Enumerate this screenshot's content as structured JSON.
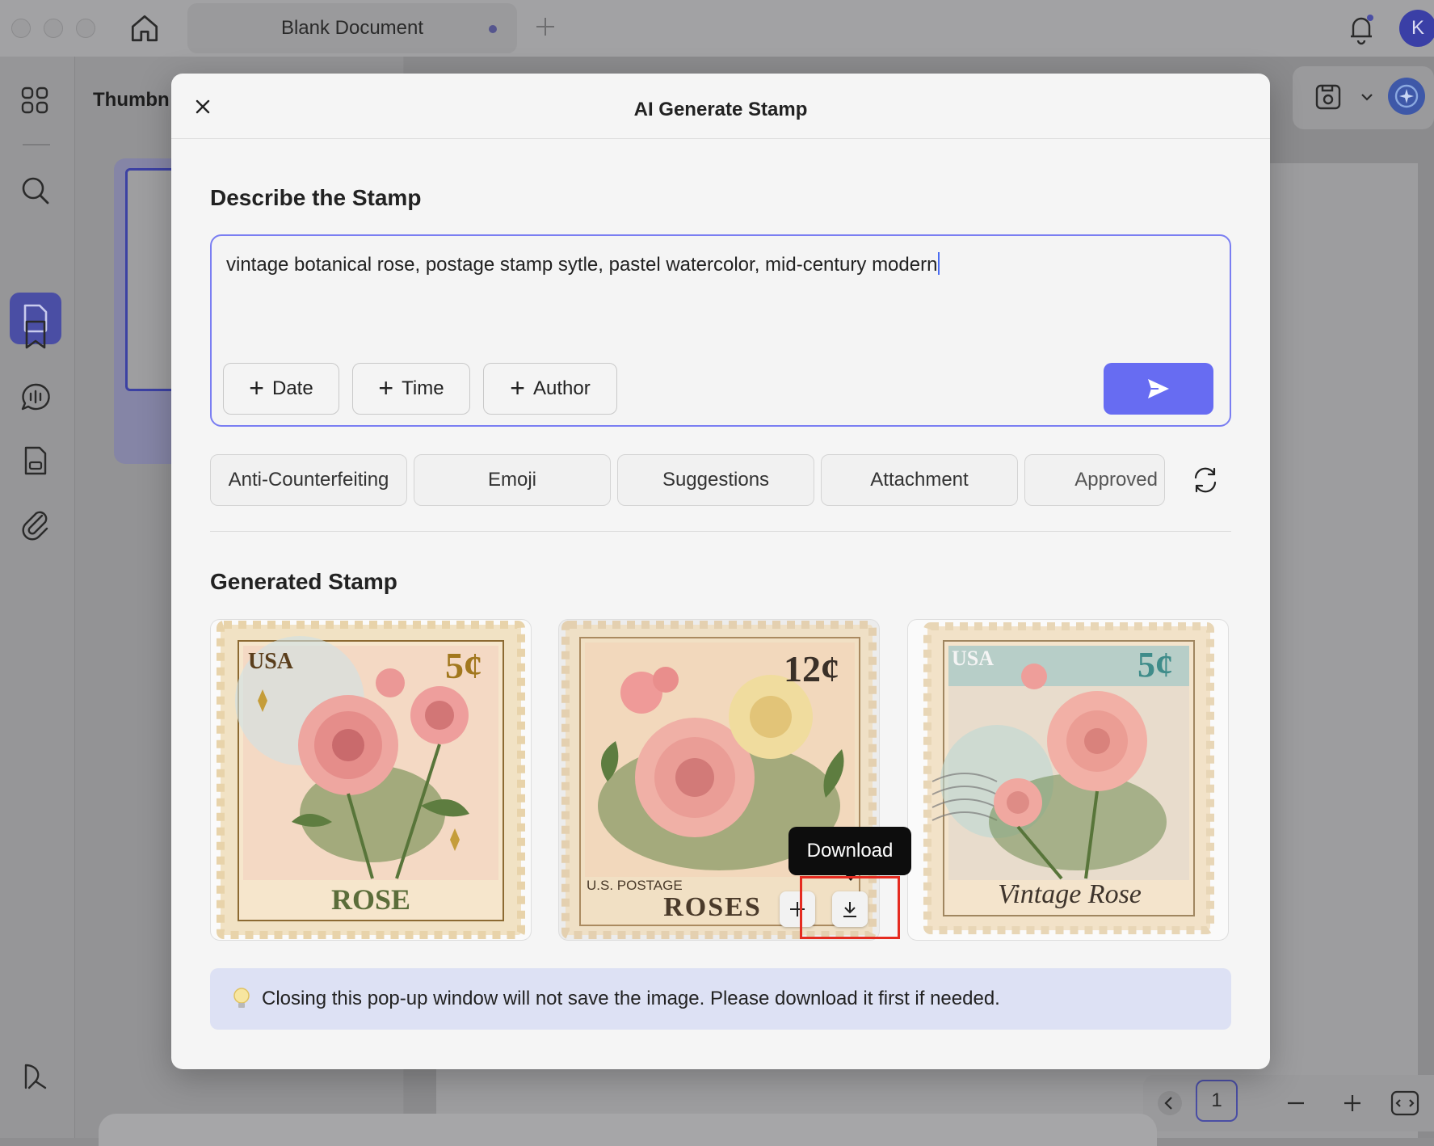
{
  "titlebar": {
    "tab_title": "Blank Document",
    "avatar_initial": "K"
  },
  "thumbnail_panel": {
    "title": "Thumbn"
  },
  "bottom_nav": {
    "page_number": "1"
  },
  "modal": {
    "title": "AI Generate Stamp",
    "describe_heading": "Describe the Stamp",
    "prompt_value": "vintage botanical rose, postage stamp sytle, pastel watercolor, mid-century modern",
    "chips": [
      "Date",
      "Time",
      "Author"
    ],
    "templates": [
      "Anti-Counterfeiting",
      "Emoji",
      "Suggestions",
      "Attachment",
      "Approved"
    ],
    "generated_heading": "Generated Stamp",
    "stamps": [
      {
        "country": "USA",
        "value": "5¢",
        "name": "ROSE"
      },
      {
        "country": "U.S. POSTAGE",
        "value": "12¢",
        "name": "ROSES"
      },
      {
        "country": "USA",
        "value": "5¢",
        "name": "Vintage Rose"
      }
    ],
    "tooltip": "Download",
    "notice": "Closing this pop-up window will not save the image. Please download it first if needed."
  },
  "colors": {
    "accent": "#676cf2",
    "highlight": "#e52b20",
    "notice_bg": "#dde1f4"
  }
}
